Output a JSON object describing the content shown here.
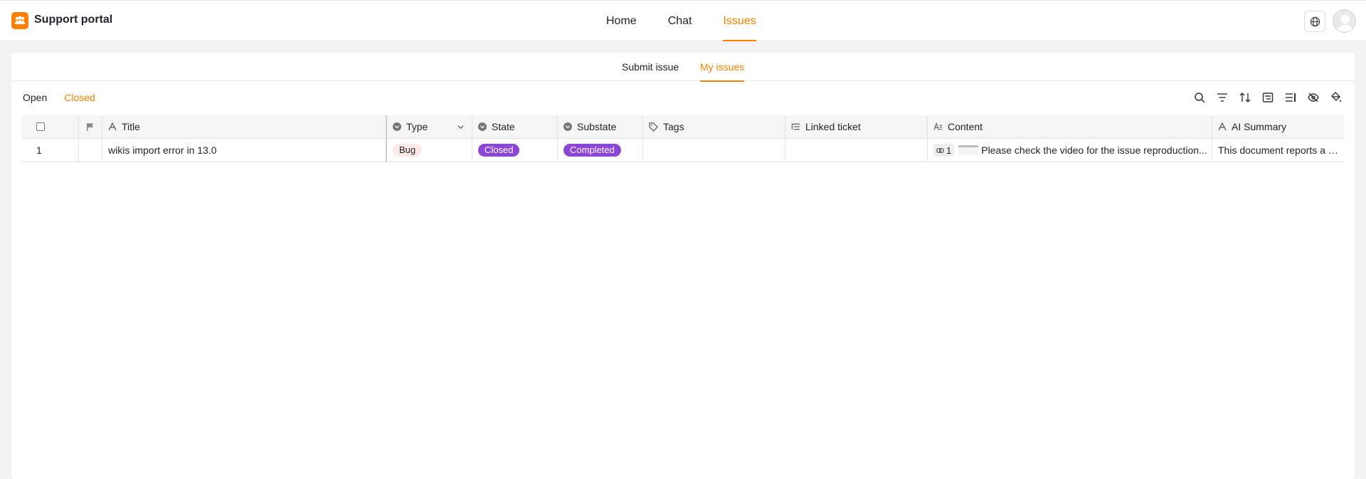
{
  "app": {
    "title": "Support portal"
  },
  "nav": {
    "items": [
      {
        "label": "Home"
      },
      {
        "label": "Chat"
      },
      {
        "label": "Issues"
      }
    ],
    "active": "Issues"
  },
  "subtabs": [
    {
      "label": "Submit issue"
    },
    {
      "label": "My issues"
    }
  ],
  "view_tabs": [
    {
      "label": "Open"
    },
    {
      "label": "Closed"
    }
  ],
  "toolbar": {
    "icons": [
      "search-icon",
      "filter-icon",
      "sort-icon",
      "group-icon",
      "row-height-icon",
      "hide-columns-icon",
      "color-fill-icon"
    ]
  },
  "table": {
    "columns": [
      {
        "label": "Title",
        "icon": "text-icon"
      },
      {
        "label": "Type",
        "icon": "single-select-icon"
      },
      {
        "label": "State",
        "icon": "single-select-icon"
      },
      {
        "label": "Substate",
        "icon": "single-select-icon"
      },
      {
        "label": "Tags",
        "icon": "tag-icon"
      },
      {
        "label": "Linked ticket",
        "icon": "link-list-icon"
      },
      {
        "label": "Content",
        "icon": "long-text-icon"
      },
      {
        "label": "AI Summary",
        "icon": "text-icon"
      }
    ],
    "rows": [
      {
        "index": "1",
        "title": "wikis import error in 13.0",
        "type": "Bug",
        "state": "Closed",
        "substate": "Completed",
        "tags": "",
        "linked_ticket": "",
        "content_attachments": "1",
        "content": "Please check the video for the issue reproduction...",
        "ai_summary": "This document reports a wi..."
      }
    ]
  },
  "colors": {
    "accent": "#ff8000",
    "status_purple": "#8e44d5",
    "bug_bg": "#fde9e7"
  }
}
